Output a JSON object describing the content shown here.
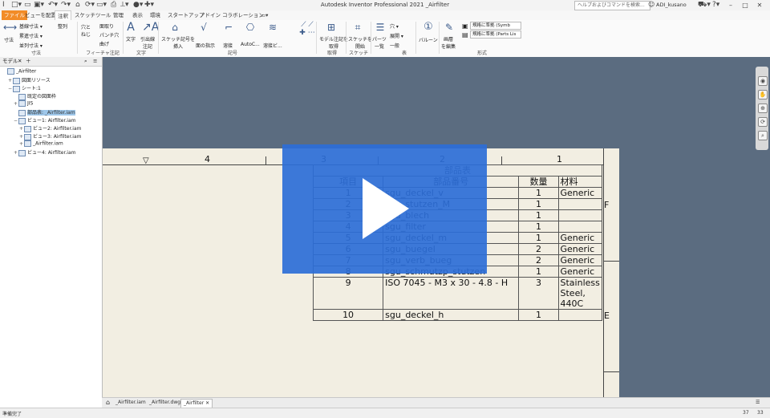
{
  "titlebar": {
    "app_title": "Autodesk Inventor Professional 2021   _Airfilter",
    "search_placeholder": "ヘルプおよびコマンドを検索...",
    "user": "ADI_kusano"
  },
  "tabs": [
    "ファイル",
    "ビューを配置",
    "注釈",
    "スケッチ",
    "ツール",
    "管理",
    "表示",
    "環境",
    "スタートアップ",
    "アドイン",
    "コラボレーション"
  ],
  "ribbon": {
    "dimension": {
      "main": "寸法",
      "items": [
        "基線寸法 ▾",
        "累進寸法 ▾",
        "並列寸法 ▾"
      ],
      "group": "寸法"
    },
    "align": "整列",
    "feature_notes": {
      "items": [
        "穴と\nねじ",
        "面取り",
        "パンチ穴",
        "曲げ"
      ],
      "group": "フィーチャ注記"
    },
    "text": {
      "items": [
        "文字",
        "引出線\n注記"
      ],
      "group": "文字"
    },
    "symbols": {
      "items": [
        "スケッチ記号を\n挿入",
        "面の指示",
        "溶接",
        "AutoC...",
        "溶接ビ..."
      ],
      "group": "記号"
    },
    "retrieve": {
      "items": [
        "モデル注記を\n取得"
      ],
      "group": "取得"
    },
    "sketch": {
      "items": [
        "スケッチを\n開始"
      ],
      "group": "スケッチ"
    },
    "table": {
      "items": [
        "パーツ\n一覧",
        "穴 ▾",
        "展開 ▾",
        "一般"
      ],
      "group": "表"
    },
    "balloon": "バルーン",
    "edit_layer": "画層\nを編集",
    "format": {
      "style_dd": "規格に準拠 (Symb",
      "layer_dd": "規格に準拠 (Parts Lis",
      "group": "形式"
    }
  },
  "browser": {
    "title": "モデル",
    "items": [
      {
        "label": "_Airfilter",
        "indent": 0,
        "exp": ""
      },
      {
        "label": "図面リソース",
        "indent": 1,
        "exp": "+"
      },
      {
        "label": "シート:1",
        "indent": 1,
        "exp": "−"
      },
      {
        "label": "既定の図面枠",
        "indent": 2,
        "exp": ""
      },
      {
        "label": "JIS",
        "indent": 2,
        "exp": "+"
      },
      {
        "label": "部品表: _Airfilter.iam",
        "indent": 2,
        "exp": "",
        "selected": true
      },
      {
        "label": "ビュー1: Airfilter.iam",
        "indent": 2,
        "exp": "−"
      },
      {
        "label": "ビュー2: Airfilter.iam",
        "indent": 3,
        "exp": "+"
      },
      {
        "label": "ビュー3: Airfilter.iam",
        "indent": 3,
        "exp": "+"
      },
      {
        "label": "_Airfilter.iam",
        "indent": 3,
        "exp": "+"
      },
      {
        "label": "ビュー4: Airfilter.iam",
        "indent": 2,
        "exp": "+"
      }
    ]
  },
  "drawing": {
    "zone_numbers": [
      "4",
      "3",
      "2",
      "1"
    ],
    "zone_letters": [
      "F",
      "E"
    ],
    "bom": {
      "title": "部品表",
      "headers": [
        "項目",
        "部品番号",
        "数量",
        "材料"
      ],
      "rows": [
        [
          "1",
          "sgu_deckel_v",
          "1",
          "Generic"
        ],
        [
          "2",
          "sgu_stutzen_M",
          "1",
          ""
        ],
        [
          "3",
          "sgu_blech",
          "1",
          ""
        ],
        [
          "4",
          "sgu_filter",
          "1",
          ""
        ],
        [
          "5",
          "sgu_deckel_m",
          "1",
          "Generic"
        ],
        [
          "6",
          "sgu_buegel",
          "2",
          "Generic"
        ],
        [
          "7",
          "sgu_verb_bueg",
          "2",
          "Generic"
        ],
        [
          "8",
          "sgu_schmutzp_stutzen",
          "1",
          "Generic"
        ],
        [
          "9",
          "ISO 7045 - M3 x 30 - 4.8 - H",
          "3",
          "Stainless Steel, 440C"
        ],
        [
          "10",
          "sgu_deckel_h",
          "1",
          ""
        ]
      ]
    }
  },
  "doc_tabs": [
    "_Airfilter.iam",
    "_Airfilter.dwg",
    "_Airfilter"
  ],
  "status": {
    "text": "準備完了",
    "num1": "37",
    "num2": "33"
  },
  "colors": {
    "file_tab": "#f28c28",
    "canvas": "#5b6c80",
    "sheet": "#f2eee2",
    "play_overlay": "#2d6ed7"
  }
}
